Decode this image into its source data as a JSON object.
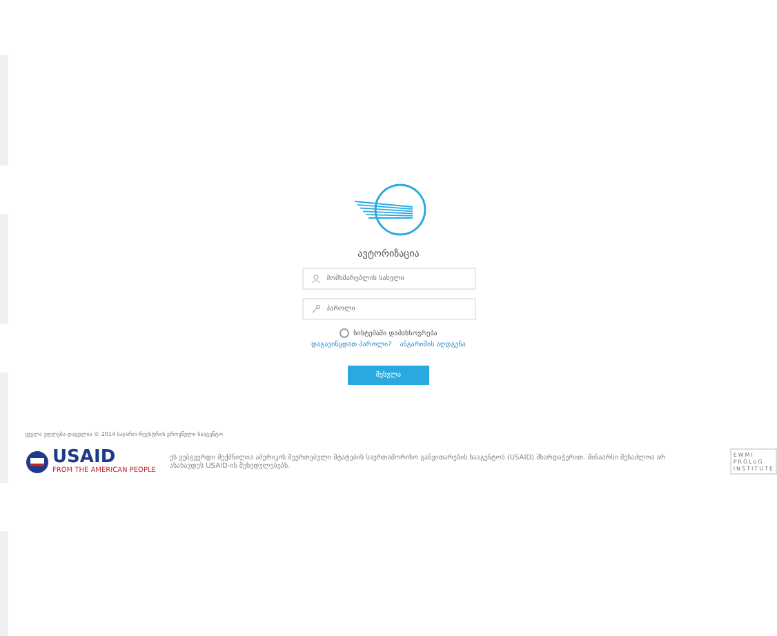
{
  "login": {
    "title": "ავტორიზაცია",
    "username": {
      "placeholder": "მომხმარებლის სახელი"
    },
    "password": {
      "placeholder": "პაროლი"
    },
    "remember": {
      "label": "სისტემაში დამახსოვრება",
      "checked": false
    },
    "links": [
      "დაგავიწყდათ პაროლი?",
      "ანგარიშის აღდგენა"
    ],
    "submit": "შესვლა"
  },
  "footer": {
    "copyright": "ყველა უფლება დაცულია © 2014 საჯარო რეესტრის ეროვნული სააგენტო",
    "sponsor_name": "USAID",
    "sponsor_tagline": "FROM THE AMERICAN PEOPLE",
    "disclaimer": "ეს ვებგვერდი შექმნილია ამერიკის შეერთებული შტატების საერთაშორისო განვითარების სააგენტოს (USAID) მხარდაჭერით. შინაარსი შესაძლოა არ ასახავდეს USAID-ის შეხედულებებს.",
    "partner_logo": [
      "EWMI",
      "PROLoG",
      "INSTITUTE"
    ]
  }
}
